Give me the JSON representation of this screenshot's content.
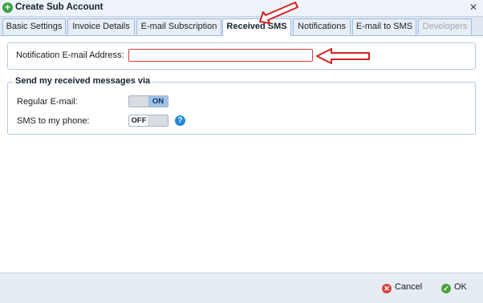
{
  "window": {
    "title": "Create Sub Account",
    "icon": "plus-circle-icon",
    "close_icon": "close-icon"
  },
  "tabs": [
    {
      "label": "Basic Settings",
      "state": "normal"
    },
    {
      "label": "Invoice Details",
      "state": "normal"
    },
    {
      "label": "E-mail Subscription",
      "state": "normal"
    },
    {
      "label": "Received SMS",
      "state": "active"
    },
    {
      "label": "Notifications",
      "state": "normal"
    },
    {
      "label": "E-mail to SMS",
      "state": "normal"
    },
    {
      "label": "Developers",
      "state": "disabled"
    }
  ],
  "notification": {
    "label": "Notification E-mail Address:",
    "value": ""
  },
  "received_via": {
    "legend": "Send my received messages via",
    "regular_email": {
      "label": "Regular E-mail:",
      "toggle": "ON"
    },
    "sms_phone": {
      "label": "SMS to my phone:",
      "toggle": "OFF",
      "help_icon": "question-icon"
    }
  },
  "footer": {
    "cancel_label": "Cancel",
    "cancel_icon": "x-circle-icon",
    "ok_label": "OK",
    "ok_icon": "check-circle-icon"
  },
  "colors": {
    "tab_border": "#99bbe8",
    "input_highlight": "#e03c3c",
    "toggle_on": "#9fc3ea",
    "annotation_arrow": "#d62020"
  }
}
